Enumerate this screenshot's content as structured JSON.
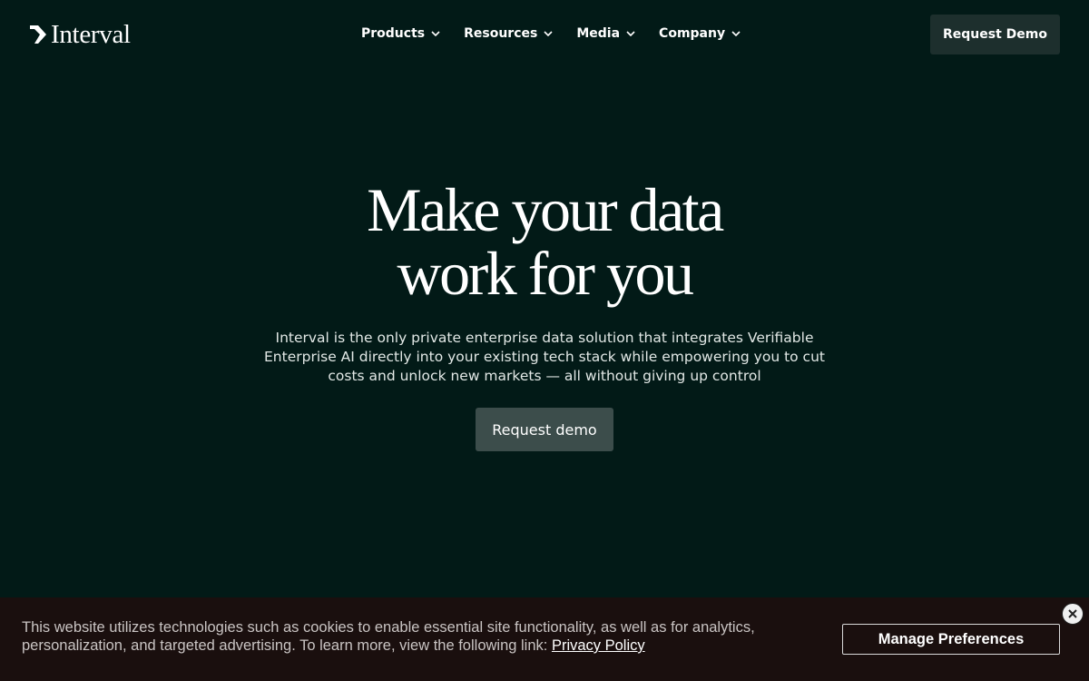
{
  "brand": {
    "name": "Interval",
    "logo_icon": "interval-chevron-icon"
  },
  "nav": {
    "items": [
      {
        "label": "Products",
        "icon": "chevron-down-icon"
      },
      {
        "label": "Resources",
        "icon": "chevron-down-icon"
      },
      {
        "label": "Media",
        "icon": "chevron-down-icon"
      },
      {
        "label": "Company",
        "icon": "chevron-down-icon"
      }
    ],
    "cta_label": "Request Demo"
  },
  "hero": {
    "title_line1": "Make your data",
    "title_line2": "work for you",
    "subtitle": "Interval is the only private enterprise data solution that integrates Verifiable Enterprise AI directly into your existing tech stack while empowering you to cut costs and unlock new markets — all without giving up control",
    "cta_label": "Request demo"
  },
  "cookie_banner": {
    "text": "This website utilizes technologies such as cookies to enable essential site functionality, as well as for analytics, personalization, and targeted advertising. To learn more, view the following link: ",
    "link_label": "Privacy Policy",
    "manage_label": "Manage Preferences",
    "close_icon": "close-icon"
  },
  "colors": {
    "background": "#021a17",
    "header_button": "#1d2f2d",
    "hero_button": "#3c4d4b",
    "banner_background": "#1a0f0e"
  }
}
